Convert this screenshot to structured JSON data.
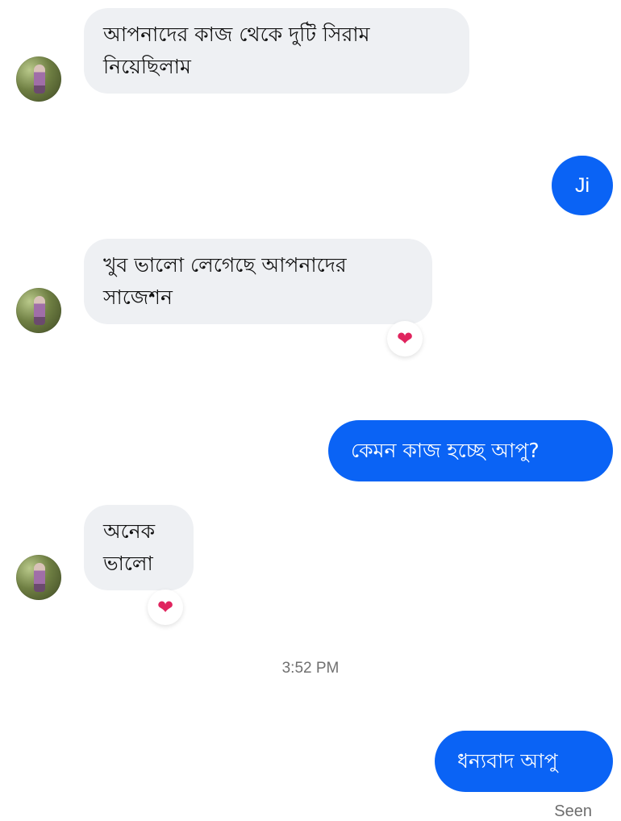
{
  "conversation": {
    "messages": [
      {
        "from": "contact",
        "text": "আপনাদের কাজ থেকে দুটি সিরাম\nনিয়েছিলাম",
        "reaction": null
      },
      {
        "from": "me",
        "text": "Ji",
        "reaction": null
      },
      {
        "from": "contact",
        "text": "খুব ভালো লেগেছে আপনাদের\nসাজেশন",
        "reaction": "❤"
      },
      {
        "from": "me",
        "text": "কেমন কাজ হচ্ছে আপু?",
        "reaction": null
      },
      {
        "from": "contact",
        "text": "অনেক\nভালো",
        "reaction": "❤"
      },
      {
        "from": "me",
        "text": "ধন্যবাদ আপু",
        "reaction": null
      }
    ],
    "timestamp": "3:52 PM",
    "status": "Seen"
  },
  "colors": {
    "outgoing_bubble": "#0a63f5",
    "incoming_bubble": "#eef0f3",
    "reaction_heart": "#e0245e"
  },
  "icons": {
    "reaction": "heart-icon",
    "avatar": "contact-avatar"
  }
}
